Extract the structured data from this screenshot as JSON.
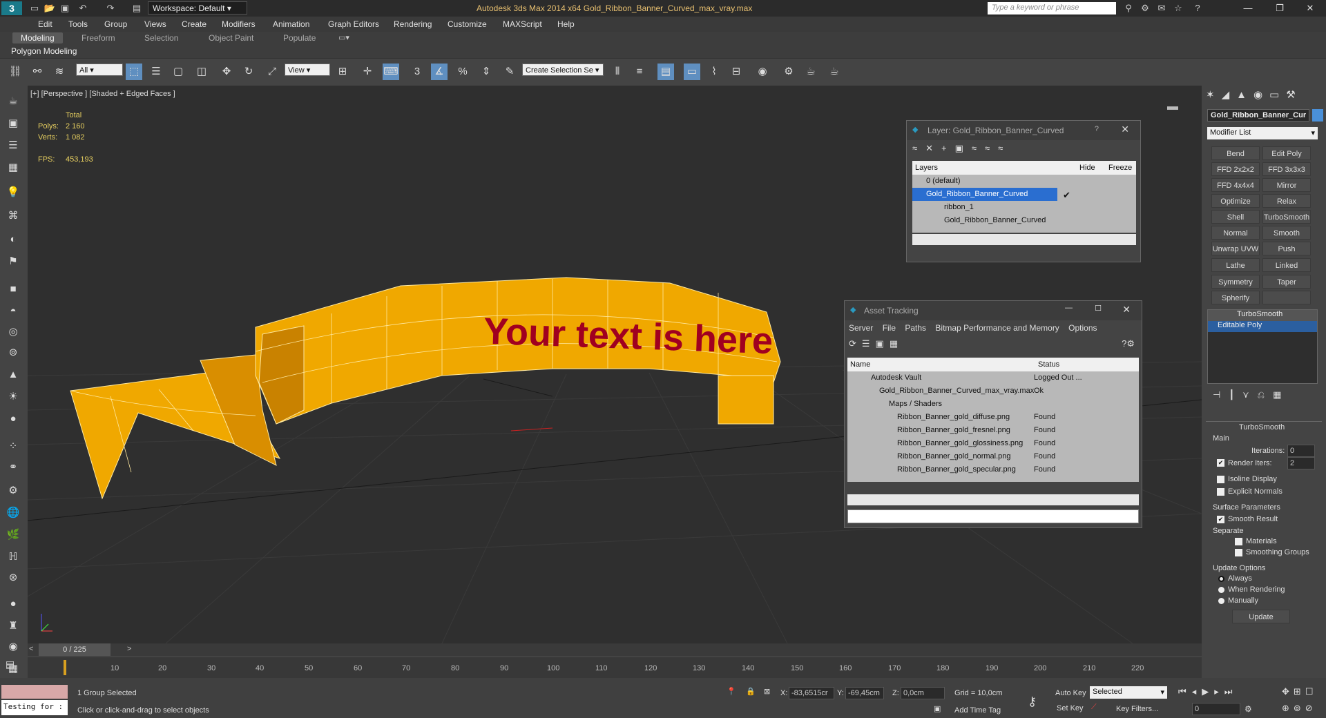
{
  "app": {
    "title": "Autodesk 3ds Max  2014 x64    Gold_Ribbon_Banner_Curved_max_vray.max",
    "workspace": "Workspace: Default",
    "search_placeholder": "Type a keyword or phrase"
  },
  "menu": [
    "Edit",
    "Tools",
    "Group",
    "Views",
    "Create",
    "Modifiers",
    "Animation",
    "Graph Editors",
    "Rendering",
    "Customize",
    "MAXScript",
    "Help"
  ],
  "ribbon_tabs": [
    "Modeling",
    "Freeform",
    "Selection",
    "Object Paint",
    "Populate"
  ],
  "ribbon_panel": "Polygon Modeling",
  "toolbar": {
    "filter": "All",
    "coord": "View",
    "named_sel": "Create Selection Se",
    "snap": "3",
    "angle": "%"
  },
  "viewport": {
    "label": "[+] [Perspective ] [Shaded + Edged Faces ]",
    "stats": {
      "header": "Total",
      "polys_label": "Polys:",
      "polys": "2 160",
      "verts_label": "Verts:",
      "verts": "1 082",
      "fps_label": "FPS:",
      "fps": "453,193"
    },
    "banner_text": "Your text is here"
  },
  "layer_dialog": {
    "title": "Layer: Gold_Ribbon_Banner_Curved",
    "columns": [
      "Layers",
      "Hide",
      "Freeze"
    ],
    "rows": [
      "0 (default)",
      "Gold_Ribbon_Banner_Curved",
      "ribbon_1",
      "Gold_Ribbon_Banner_Curved"
    ]
  },
  "asset_dialog": {
    "title": "Asset Tracking",
    "menu": [
      "Server",
      "File",
      "Paths",
      "Bitmap Performance and Memory",
      "Options"
    ],
    "columns": [
      "Name",
      "Status"
    ],
    "rows": [
      {
        "name": "Autodesk Vault",
        "status": "Logged Out ..."
      },
      {
        "name": "Gold_Ribbon_Banner_Curved_max_vray.max",
        "status": "Ok"
      },
      {
        "name": "Maps / Shaders",
        "status": ""
      },
      {
        "name": "Ribbon_Banner_gold_diffuse.png",
        "status": "Found"
      },
      {
        "name": "Ribbon_Banner_gold_fresnel.png",
        "status": "Found"
      },
      {
        "name": "Ribbon_Banner_gold_glossiness.png",
        "status": "Found"
      },
      {
        "name": "Ribbon_Banner_gold_normal.png",
        "status": "Found"
      },
      {
        "name": "Ribbon_Banner_gold_specular.png",
        "status": "Found"
      }
    ]
  },
  "command_panel": {
    "object_name": "Gold_Ribbon_Banner_Cur",
    "modifier_list": "Modifier List",
    "modifier_buttons": [
      "Bend",
      "Edit Poly",
      "FFD 2x2x2",
      "FFD 3x3x3",
      "FFD 4x4x4",
      "Mirror",
      "Optimize",
      "Relax",
      "Shell",
      "TurboSmooth",
      "Normal",
      "Smooth",
      "Unwrap UVW",
      "Push",
      "Lathe",
      "Linked XForm",
      "Symmetry",
      "Taper",
      "Spherify",
      ""
    ],
    "stack": [
      "TurboSmooth",
      "Editable Poly"
    ],
    "turbosmooth": {
      "title": "TurboSmooth",
      "main": "Main",
      "iterations_label": "Iterations:",
      "iterations": "0",
      "render_iters_label": "Render Iters:",
      "render_iters": "2",
      "isoline": "Isoline Display",
      "explicit_normals": "Explicit Normals",
      "surface_params": "Surface Parameters",
      "smooth_result": "Smooth Result",
      "separate": "Separate",
      "materials": "Materials",
      "smoothing_groups": "Smoothing Groups",
      "update_options": "Update Options",
      "always": "Always",
      "when_rendering": "When Rendering",
      "manually": "Manually",
      "update_btn": "Update"
    }
  },
  "timeline": {
    "frame": "0 / 225",
    "ticks": [
      "10",
      "20",
      "30",
      "40",
      "50",
      "60",
      "70",
      "80",
      "90",
      "100",
      "110",
      "120",
      "130",
      "140",
      "150",
      "160",
      "170",
      "180",
      "190",
      "200",
      "210",
      "220"
    ]
  },
  "status": {
    "script_box": "Testing for :",
    "selected": "1 Group Selected",
    "prompt": "Click or click-and-drag to select objects",
    "x_label": "X:",
    "x": "-83,6515cr",
    "y_label": "Y:",
    "y": "-69,45cm",
    "z_label": "Z:",
    "z": "0,0cm",
    "grid": "Grid = 10,0cm",
    "add_time_tag": "Add Time Tag",
    "auto_key": "Auto Key",
    "set_key": "Set Key",
    "selected_dd": "Selected",
    "key_filters": "Key Filters...",
    "frame_field": "0"
  }
}
